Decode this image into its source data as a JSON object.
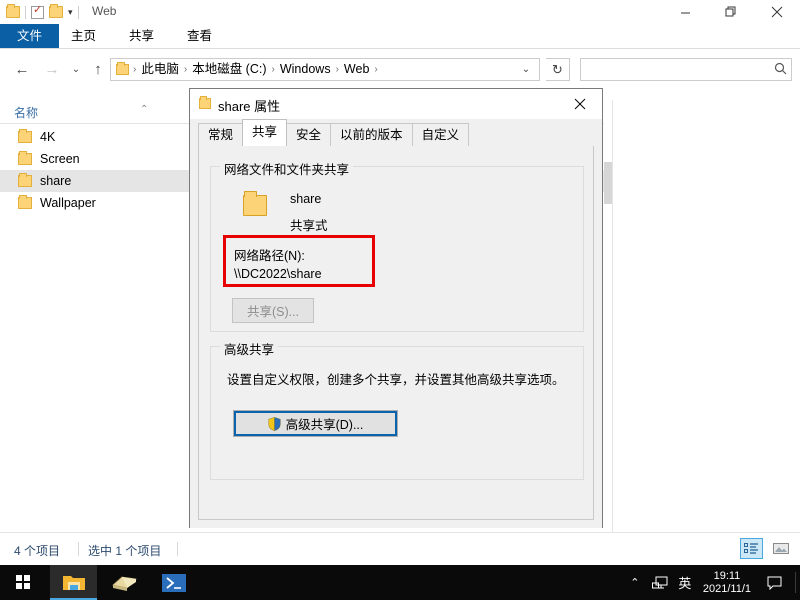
{
  "explorer": {
    "window_title": "Web",
    "quick_access": [
      "folder-icon",
      "properties-icon",
      "new-folder-icon",
      "customize-chevron-icon"
    ],
    "ribbon_tabs": [
      {
        "label": "文件",
        "active": true
      },
      {
        "label": "主页",
        "active": false
      },
      {
        "label": "共享",
        "active": false
      },
      {
        "label": "查看",
        "active": false
      }
    ],
    "window_buttons": {
      "minimize": "—",
      "restore": "❐",
      "close": "✕"
    },
    "ribbon_collapse": "⌄",
    "help": "?",
    "nav": {
      "back": "←",
      "forward": "→",
      "recent": "⌄",
      "up": "↑"
    },
    "breadcrumb": [
      "此电脑",
      "本地磁盘 (C:)",
      "Windows",
      "Web"
    ],
    "breadcrumb_separator": "›",
    "address_dropdown": "⌄",
    "refresh": "↻",
    "search": {
      "value": "",
      "placeholder": "",
      "icon": "search-icon"
    },
    "column_header": "名称",
    "files": [
      {
        "name": "4K",
        "selected": false
      },
      {
        "name": "Screen",
        "selected": false
      },
      {
        "name": "share",
        "selected": true
      },
      {
        "name": "Wallpaper",
        "selected": false
      }
    ],
    "status": {
      "item_count": "4 个项目",
      "selection": "选中 1 个项目"
    },
    "view_buttons": [
      {
        "name": "details-view",
        "active": true
      },
      {
        "name": "large-icons-view",
        "active": false
      }
    ]
  },
  "dialog": {
    "title": "share 属性",
    "close": "✕",
    "tabs": [
      {
        "label": "常规",
        "active": false
      },
      {
        "label": "共享",
        "active": true
      },
      {
        "label": "安全",
        "active": false
      },
      {
        "label": "以前的版本",
        "active": false
      },
      {
        "label": "自定义",
        "active": false
      }
    ],
    "network_group": {
      "legend": "网络文件和文件夹共享",
      "folder_name": "share",
      "share_state": "共享式",
      "network_path_label": "网络路径(N):",
      "network_path_value": "\\\\DC2022\\share",
      "share_button": "共享(S)...",
      "share_button_disabled": true,
      "highlight_color": "#e60000"
    },
    "advanced_group": {
      "legend": "高级共享",
      "description": "设置自定义权限，创建多个共享，并设置其他高级共享选项。",
      "button": "高级共享(D)...",
      "button_icon": "uac-shield-icon",
      "focus_color": "#0a64ad"
    }
  },
  "taskbar": {
    "start": "windows-logo-icon",
    "items": [
      {
        "name": "file-explorer",
        "active": true
      },
      {
        "name": "sandbox-app",
        "active": false
      },
      {
        "name": "powershell",
        "active": false
      }
    ],
    "tray": {
      "overflow": "⌃",
      "network": "network-icon",
      "ime": "英",
      "time": "19:11",
      "date": "2021/11/1",
      "action_center": "action-center-icon"
    }
  }
}
